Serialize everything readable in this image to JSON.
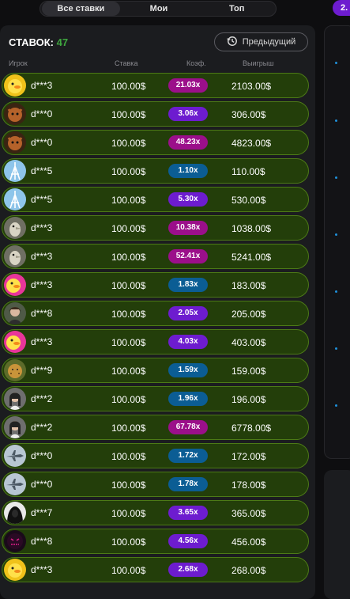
{
  "tabs": [
    {
      "label": "Все ставки",
      "active": true
    },
    {
      "label": "Мои",
      "active": false
    },
    {
      "label": "Топ",
      "active": false
    }
  ],
  "multiplier_pill": "2.",
  "panel": {
    "bets_label": "СТАВОК:",
    "bets_count": "47",
    "previous_button": "Предыдущий",
    "columns": {
      "player": "Игрок",
      "bet": "Ставка",
      "coef": "Коэф.",
      "win": "Выигрыш"
    }
  },
  "colors": {
    "row_bg": "#233e0a",
    "coef_purple": "#6d1ccf",
    "coef_magenta": "#9b0f8a",
    "coef_blue": "#0b5d94",
    "count_green": "#3fa73f"
  },
  "rows": [
    {
      "player": "d***3",
      "bet": "100.00",
      "coef": "21.03x",
      "win": "2103.00",
      "tier": "magenta",
      "avatar": "duck-avatar"
    },
    {
      "player": "d***0",
      "bet": "100.00",
      "coef": "3.06x",
      "win": "306.00",
      "tier": "purple",
      "avatar": "cat-avatar"
    },
    {
      "player": "d***0",
      "bet": "100.00",
      "coef": "48.23x",
      "win": "4823.00",
      "tier": "magenta",
      "avatar": "cat-avatar"
    },
    {
      "player": "d***5",
      "bet": "100.00",
      "coef": "1.10x",
      "win": "110.00",
      "tier": "blue",
      "avatar": "tower-avatar"
    },
    {
      "player": "d***5",
      "bet": "100.00",
      "coef": "5.30x",
      "win": "530.00",
      "tier": "purple",
      "avatar": "tower-avatar"
    },
    {
      "player": "d***3",
      "bet": "100.00",
      "coef": "10.38x",
      "win": "1038.00",
      "tier": "magenta",
      "avatar": "bird-avatar"
    },
    {
      "player": "d***3",
      "bet": "100.00",
      "coef": "52.41x",
      "win": "5241.00",
      "tier": "magenta",
      "avatar": "bird-avatar"
    },
    {
      "player": "d***3",
      "bet": "100.00",
      "coef": "1.83x",
      "win": "183.00",
      "tier": "blue",
      "avatar": "duck-pink-avatar"
    },
    {
      "player": "d***8",
      "bet": "100.00",
      "coef": "2.05x",
      "win": "205.00",
      "tier": "purple",
      "avatar": "girl-avatar"
    },
    {
      "player": "d***3",
      "bet": "100.00",
      "coef": "4.03x",
      "win": "403.00",
      "tier": "purple",
      "avatar": "duck-pink-avatar"
    },
    {
      "player": "d***9",
      "bet": "100.00",
      "coef": "1.59x",
      "win": "159.00",
      "tier": "blue",
      "avatar": "cheetah-avatar"
    },
    {
      "player": "d***2",
      "bet": "100.00",
      "coef": "1.96x",
      "win": "196.00",
      "tier": "blue",
      "avatar": "woman-avatar"
    },
    {
      "player": "d***2",
      "bet": "100.00",
      "coef": "67.78x",
      "win": "6778.00",
      "tier": "magenta",
      "avatar": "woman-avatar"
    },
    {
      "player": "d***0",
      "bet": "100.00",
      "coef": "1.72x",
      "win": "172.00",
      "tier": "blue",
      "avatar": "jet-avatar"
    },
    {
      "player": "d***0",
      "bet": "100.00",
      "coef": "1.78x",
      "win": "178.00",
      "tier": "blue",
      "avatar": "jet-avatar"
    },
    {
      "player": "d***7",
      "bet": "100.00",
      "coef": "3.65x",
      "win": "365.00",
      "tier": "purple",
      "avatar": "hood-avatar"
    },
    {
      "player": "d***8",
      "bet": "100.00",
      "coef": "4.56x",
      "win": "456.00",
      "tier": "purple",
      "avatar": "mask-avatar"
    },
    {
      "player": "d***3",
      "bet": "100.00",
      "coef": "2.68x",
      "win": "268.00",
      "tier": "purple",
      "avatar": "duck-avatar"
    }
  ],
  "currency_symbol": "$"
}
